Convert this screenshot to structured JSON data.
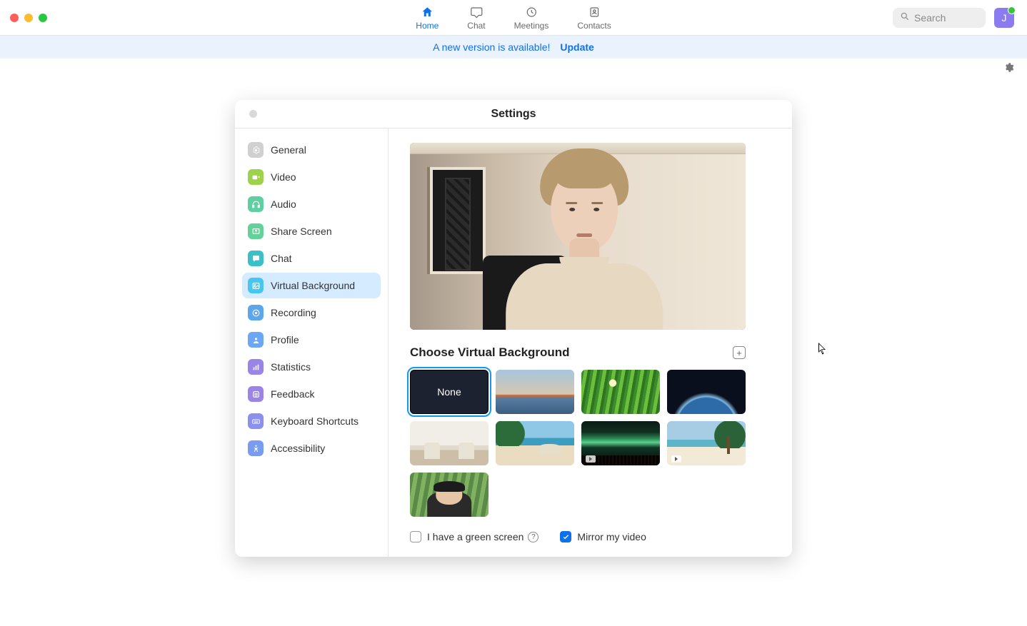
{
  "nav": {
    "tabs": [
      {
        "id": "home",
        "label": "Home",
        "icon": "home-icon"
      },
      {
        "id": "chat",
        "label": "Chat",
        "icon": "chat-bubble-icon"
      },
      {
        "id": "meetings",
        "label": "Meetings",
        "icon": "clock-icon"
      },
      {
        "id": "contacts",
        "label": "Contacts",
        "icon": "contacts-icon"
      }
    ],
    "active_tab": "home",
    "search_placeholder": "Search",
    "avatar_initial": "J"
  },
  "banner": {
    "message": "A new version is available!",
    "action_label": "Update"
  },
  "settings": {
    "title": "Settings",
    "sidebar": {
      "items": [
        {
          "id": "general",
          "label": "General",
          "color": "#d0d0d0",
          "icon": "gear-icon"
        },
        {
          "id": "video",
          "label": "Video",
          "color": "#9fd24b",
          "icon": "video-icon"
        },
        {
          "id": "audio",
          "label": "Audio",
          "color": "#5dcfa2",
          "icon": "headphones-icon"
        },
        {
          "id": "share",
          "label": "Share Screen",
          "color": "#62d29a",
          "icon": "share-screen-icon"
        },
        {
          "id": "chat",
          "label": "Chat",
          "color": "#3ac0c8",
          "icon": "chat-icon"
        },
        {
          "id": "vbg",
          "label": "Virtual Background",
          "color": "#45c7ef",
          "icon": "virtual-bg-icon"
        },
        {
          "id": "recording",
          "label": "Recording",
          "color": "#5aa7f0",
          "icon": "record-icon"
        },
        {
          "id": "profile",
          "label": "Profile",
          "color": "#6ba7f5",
          "icon": "profile-icon"
        },
        {
          "id": "stats",
          "label": "Statistics",
          "color": "#9b84e8",
          "icon": "stats-icon"
        },
        {
          "id": "feedback",
          "label": "Feedback",
          "color": "#9b84e8",
          "icon": "feedback-icon"
        },
        {
          "id": "keys",
          "label": "Keyboard Shortcuts",
          "color": "#8b90ea",
          "icon": "keyboard-icon"
        },
        {
          "id": "a11y",
          "label": "Accessibility",
          "color": "#7a9cf0",
          "icon": "accessibility-icon"
        }
      ],
      "selected": "vbg"
    },
    "panel": {
      "section_title": "Choose Virtual Background",
      "add_button_title": "Add Image or Video",
      "backgrounds": [
        {
          "id": "none",
          "kind": "none",
          "label": "None",
          "selected": true
        },
        {
          "id": "bridge",
          "kind": "image"
        },
        {
          "id": "grass",
          "kind": "image"
        },
        {
          "id": "earth",
          "kind": "image"
        },
        {
          "id": "room",
          "kind": "image"
        },
        {
          "id": "beach1",
          "kind": "image"
        },
        {
          "id": "aurora",
          "kind": "video"
        },
        {
          "id": "beach2",
          "kind": "video"
        },
        {
          "id": "person",
          "kind": "image"
        }
      ],
      "green_screen": {
        "label": "I have a green screen",
        "checked": false
      },
      "mirror": {
        "label": "Mirror my video",
        "checked": true
      },
      "help_symbol": "?"
    }
  }
}
